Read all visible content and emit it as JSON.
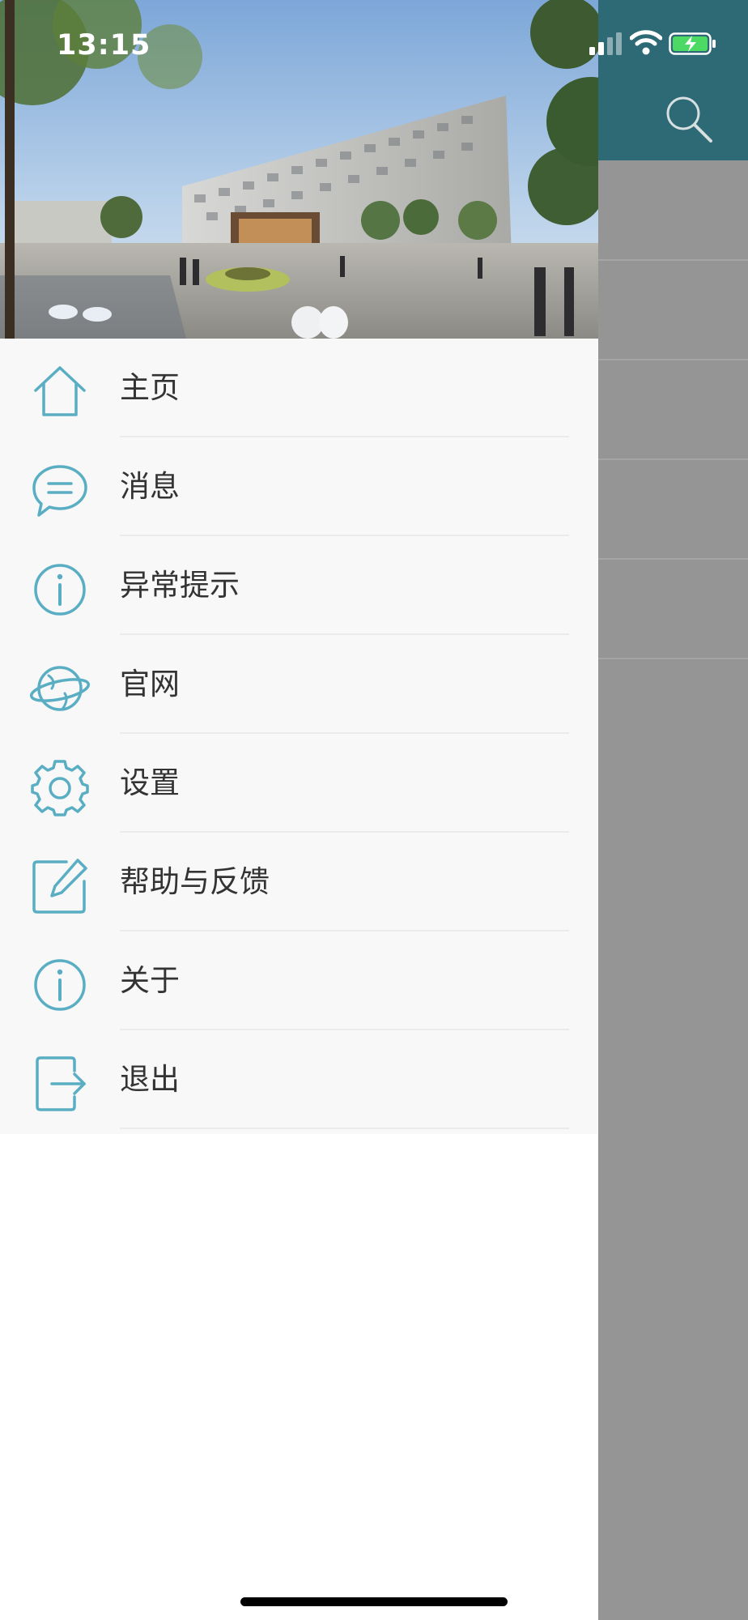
{
  "status_bar": {
    "time": "13:15",
    "battery_color": "#4cd964"
  },
  "header": {
    "color": "#2d6a75",
    "search_icon": "search-icon"
  },
  "drawer": {
    "hero_image": "campus-building-photo",
    "accent_color": "#5aaec3",
    "items": [
      {
        "label": "主页",
        "icon": "home-icon"
      },
      {
        "label": "消息",
        "icon": "message-icon"
      },
      {
        "label": "异常提示",
        "icon": "info-icon"
      },
      {
        "label": "官网",
        "icon": "globe-icon"
      },
      {
        "label": "设置",
        "icon": "gear-icon"
      },
      {
        "label": "帮助与反馈",
        "icon": "edit-icon"
      },
      {
        "label": "关于",
        "icon": "info-icon"
      },
      {
        "label": "退出",
        "icon": "logout-icon"
      }
    ]
  }
}
